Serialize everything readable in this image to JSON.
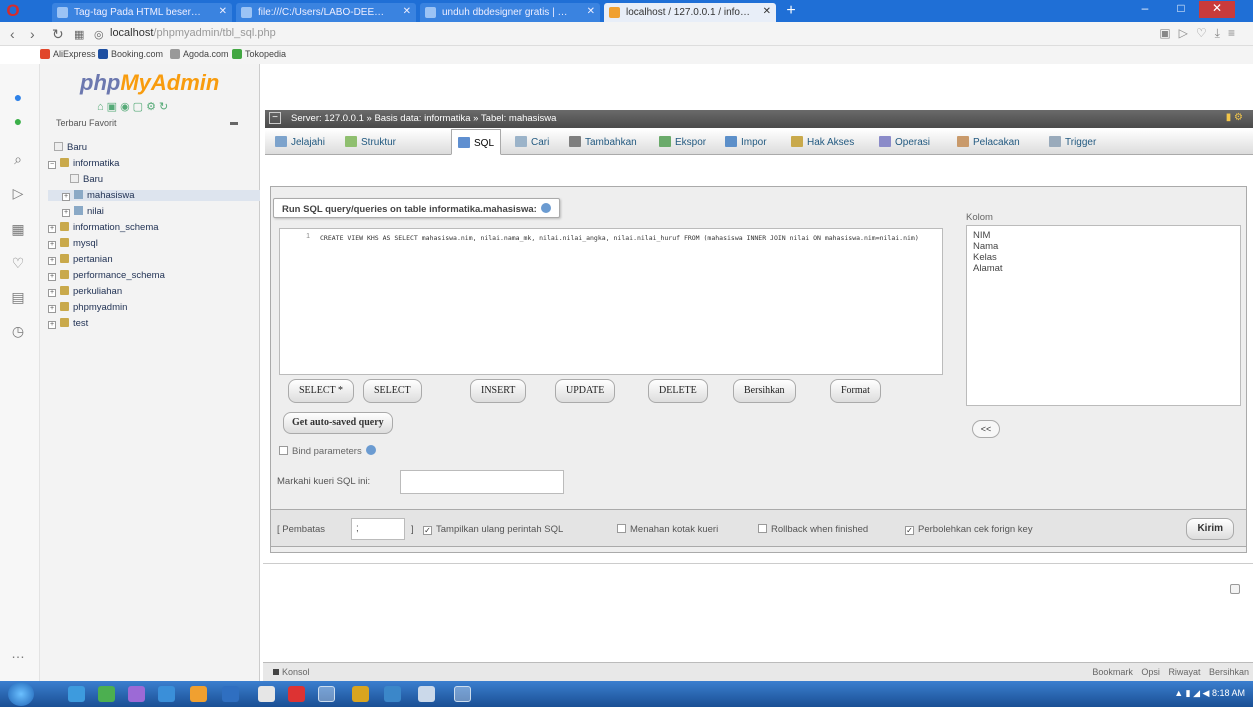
{
  "browser": {
    "tabs": [
      {
        "label": "Tag-tag Pada HTML beser…",
        "favicon": "tag-favicon"
      },
      {
        "label": "file:///C:/Users/LABO-DEE…",
        "favicon": "file-favicon"
      },
      {
        "label": "unduh dbdesigner gratis | …",
        "favicon": "download-favicon"
      },
      {
        "label": "localhost / 127.0.0.1 / info…",
        "favicon": "phpmyadmin-favicon"
      }
    ],
    "new_tab_label": "+",
    "url_host": "localhost",
    "url_path": "/phpmyadmin/tbl_sql.php",
    "bookmarks": [
      {
        "label": "AliExpress",
        "color": "#e1462b"
      },
      {
        "label": "Booking.com",
        "color": "#1e4fa1"
      },
      {
        "label": "Agoda.com",
        "color": "#999999"
      },
      {
        "label": "Tokopedia",
        "color": "#42a742"
      }
    ]
  },
  "nav": {
    "logo_php": "php",
    "logo_myadmin": "MyAdmin",
    "recent_favorites": "Terbaru   Favorit",
    "tree": [
      {
        "label": "Baru",
        "level": 0,
        "type": "new"
      },
      {
        "label": "informatika",
        "level": 0,
        "type": "db",
        "expanded": true
      },
      {
        "label": "Baru",
        "level": 1,
        "type": "new"
      },
      {
        "label": "mahasiswa",
        "level": 1,
        "type": "table",
        "selected": true
      },
      {
        "label": "nilai",
        "level": 1,
        "type": "table"
      },
      {
        "label": "information_schema",
        "level": 0,
        "type": "db"
      },
      {
        "label": "mysql",
        "level": 0,
        "type": "db"
      },
      {
        "label": "pertanian",
        "level": 0,
        "type": "db"
      },
      {
        "label": "performance_schema",
        "level": 0,
        "type": "db"
      },
      {
        "label": "perkuliahan",
        "level": 0,
        "type": "db"
      },
      {
        "label": "phpmyadmin",
        "level": 0,
        "type": "db"
      },
      {
        "label": "test",
        "level": 0,
        "type": "db"
      }
    ]
  },
  "breadcrumb": "Server: 127.0.0.1 » Basis data: informatika » Tabel: mahasiswa",
  "menu": [
    {
      "label": "Jelajahi",
      "icon": "browse-icon",
      "color": "#7da3cc"
    },
    {
      "label": "Struktur",
      "icon": "structure-icon",
      "color": "#8fbf6f"
    },
    {
      "label": "SQL",
      "icon": "sql-icon",
      "color": "#5f8fd0",
      "active": true
    },
    {
      "label": "Cari",
      "icon": "search-icon",
      "color": "#9bb3c9"
    },
    {
      "label": "Tambahkan",
      "icon": "insert-icon",
      "color": "#7f7f7f"
    },
    {
      "label": "Ekspor",
      "icon": "export-icon",
      "color": "#6aaa6a"
    },
    {
      "label": "Impor",
      "icon": "import-icon",
      "color": "#5c8fc9"
    },
    {
      "label": "Hak Akses",
      "icon": "privileges-icon",
      "color": "#c9a94b"
    },
    {
      "label": "Operasi",
      "icon": "wrench-icon",
      "color": "#8b8bc9"
    },
    {
      "label": "Pelacakan",
      "icon": "tracking-icon",
      "color": "#c99a6b"
    },
    {
      "label": "Trigger",
      "icon": "trigger-icon",
      "color": "#9ab"
    }
  ],
  "sql_panel": {
    "legend": "Run SQL query/queries on table informatika.mahasiswa:",
    "line_number": "1",
    "query": "CREATE VIEW KHS AS SELECT mahasiswa.nim, nilai.nama_mk, nilai.nilai_angka, nilai.nilai_huruf FROM (mahasiswa INNER JOIN nilai ON mahasiswa.nim=nilai.nim)",
    "columns_label": "Kolom",
    "columns": [
      "NIM",
      "Nama",
      "Kelas",
      "Alamat"
    ],
    "insert_btn": "<<",
    "buttons": [
      "SELECT *",
      "SELECT",
      "INSERT",
      "UPDATE",
      "DELETE",
      "Bersihkan",
      "Format"
    ],
    "autosaved_btn": "Get auto-saved query",
    "bind_params_label": "Bind parameters",
    "bookmark_label": "Markahi kueri SQL ini:",
    "bookmark_value": ""
  },
  "options": {
    "delimiter_label": "[ Pembatas",
    "delimiter_value": ";",
    "delimiter_close": "]",
    "show_query": "Tampilkan ulang perintah SQL",
    "show_query_checked": true,
    "retain_box": "Menahan kotak kueri",
    "retain_box_checked": false,
    "rollback": "Rollback when finished",
    "rollback_checked": false,
    "fk_checks": "Perbolehkan cek forign key",
    "fk_checks_checked": true,
    "go_btn": "Kirim"
  },
  "console": {
    "label": "Konsol",
    "links": [
      "Bookmark",
      "Opsi",
      "Riwayat",
      "Bersihkan"
    ]
  },
  "taskbar": {
    "clock": "8:18 AM"
  }
}
